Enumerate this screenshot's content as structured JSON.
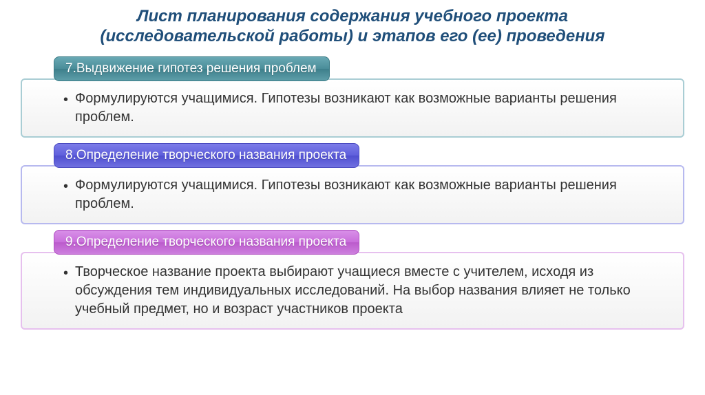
{
  "title_line1": "Лист планирования содержания учебного проекта",
  "title_line2": "(исследовательской работы) и этапов его (ее) проведения",
  "sections": [
    {
      "tab": "7.Выдвижение гипотез решения проблем",
      "body": "Формулируются учащимися. Гипотезы возникают как возможные варианты решения проблем."
    },
    {
      "tab": "8.Определение творческого названия проекта",
      "body": "Формулируются учащимися. Гипотезы возникают как возможные варианты решения проблем."
    },
    {
      "tab": "9.Определение творческого названия проекта",
      "body": "Творческое название проекта выбирают учащиеся вместе с учителем, исходя из обсуждения тем индивидуальных исследований. На выбор названия влияет не только учебный предмет, но и возраст участников проекта"
    }
  ],
  "bullet": "•"
}
